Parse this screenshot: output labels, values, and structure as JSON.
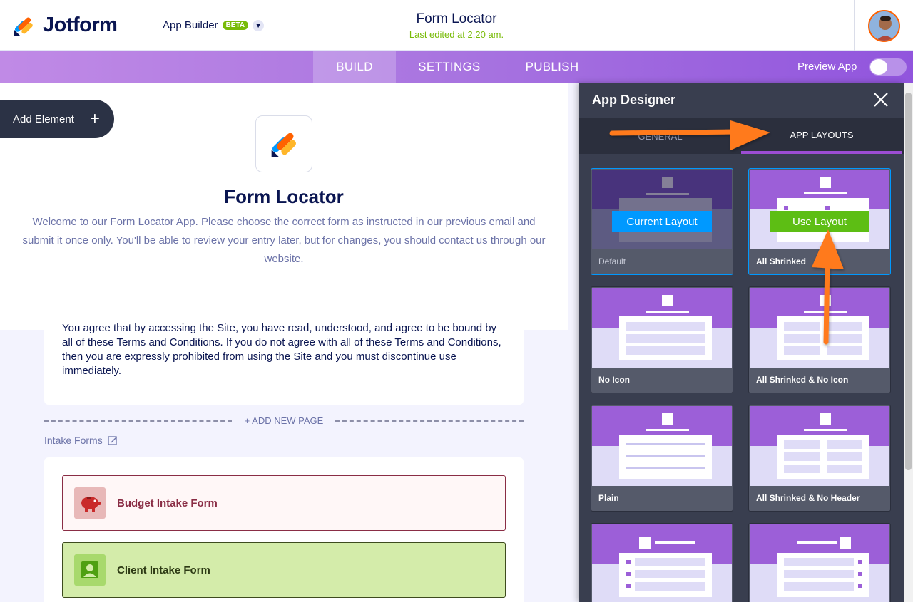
{
  "header": {
    "brand": "Jotform",
    "product": "App Builder",
    "badge": "BETA",
    "title": "Form Locator",
    "subtitle": "Last edited at 2:20 am."
  },
  "nav": {
    "tabs": [
      "BUILD",
      "SETTINGS",
      "PUBLISH"
    ],
    "active": "BUILD",
    "preview_label": "Preview App"
  },
  "canvas": {
    "add_element": "Add Element",
    "app_title": "Form Locator",
    "app_description": "Welcome to our Form Locator App. Please choose the correct form as instructed in our previous email and submit it once only. You'll be able to review your entry later, but for changes, you should contact us through our website.",
    "terms_text": "You agree that by accessing the Site, you have read, understood, and agree to be bound by all of these Terms and Conditions. If you do not agree with all of these Terms and Conditions, then you are expressly prohibited from using the Site and you must discontinue use immediately.",
    "add_new_page": "+ ADD NEW PAGE",
    "section_label": "Intake Forms",
    "forms": [
      {
        "label": "Budget Intake Form",
        "icon": "piggy-bank-icon"
      },
      {
        "label": "Client Intake Form",
        "icon": "person-id-icon"
      }
    ]
  },
  "designer": {
    "title": "App Designer",
    "tabs": {
      "general": "GENERAL",
      "layouts": "APP LAYOUTS"
    },
    "active_tab": "APP LAYOUTS",
    "layouts": [
      {
        "name": "Default",
        "state": "current",
        "button": "Current Layout"
      },
      {
        "name": "All Shrinked",
        "state": "hover",
        "button": "Use Layout"
      },
      {
        "name": "No Icon"
      },
      {
        "name": "All Shrinked & No Icon"
      },
      {
        "name": "Plain"
      },
      {
        "name": "All Shrinked & No Header"
      }
    ]
  },
  "colors": {
    "accent_purple": "#9c5fd8",
    "current_blue": "#0099ff",
    "use_green": "#5dbe14",
    "annotation_orange": "#ff7a1a"
  }
}
